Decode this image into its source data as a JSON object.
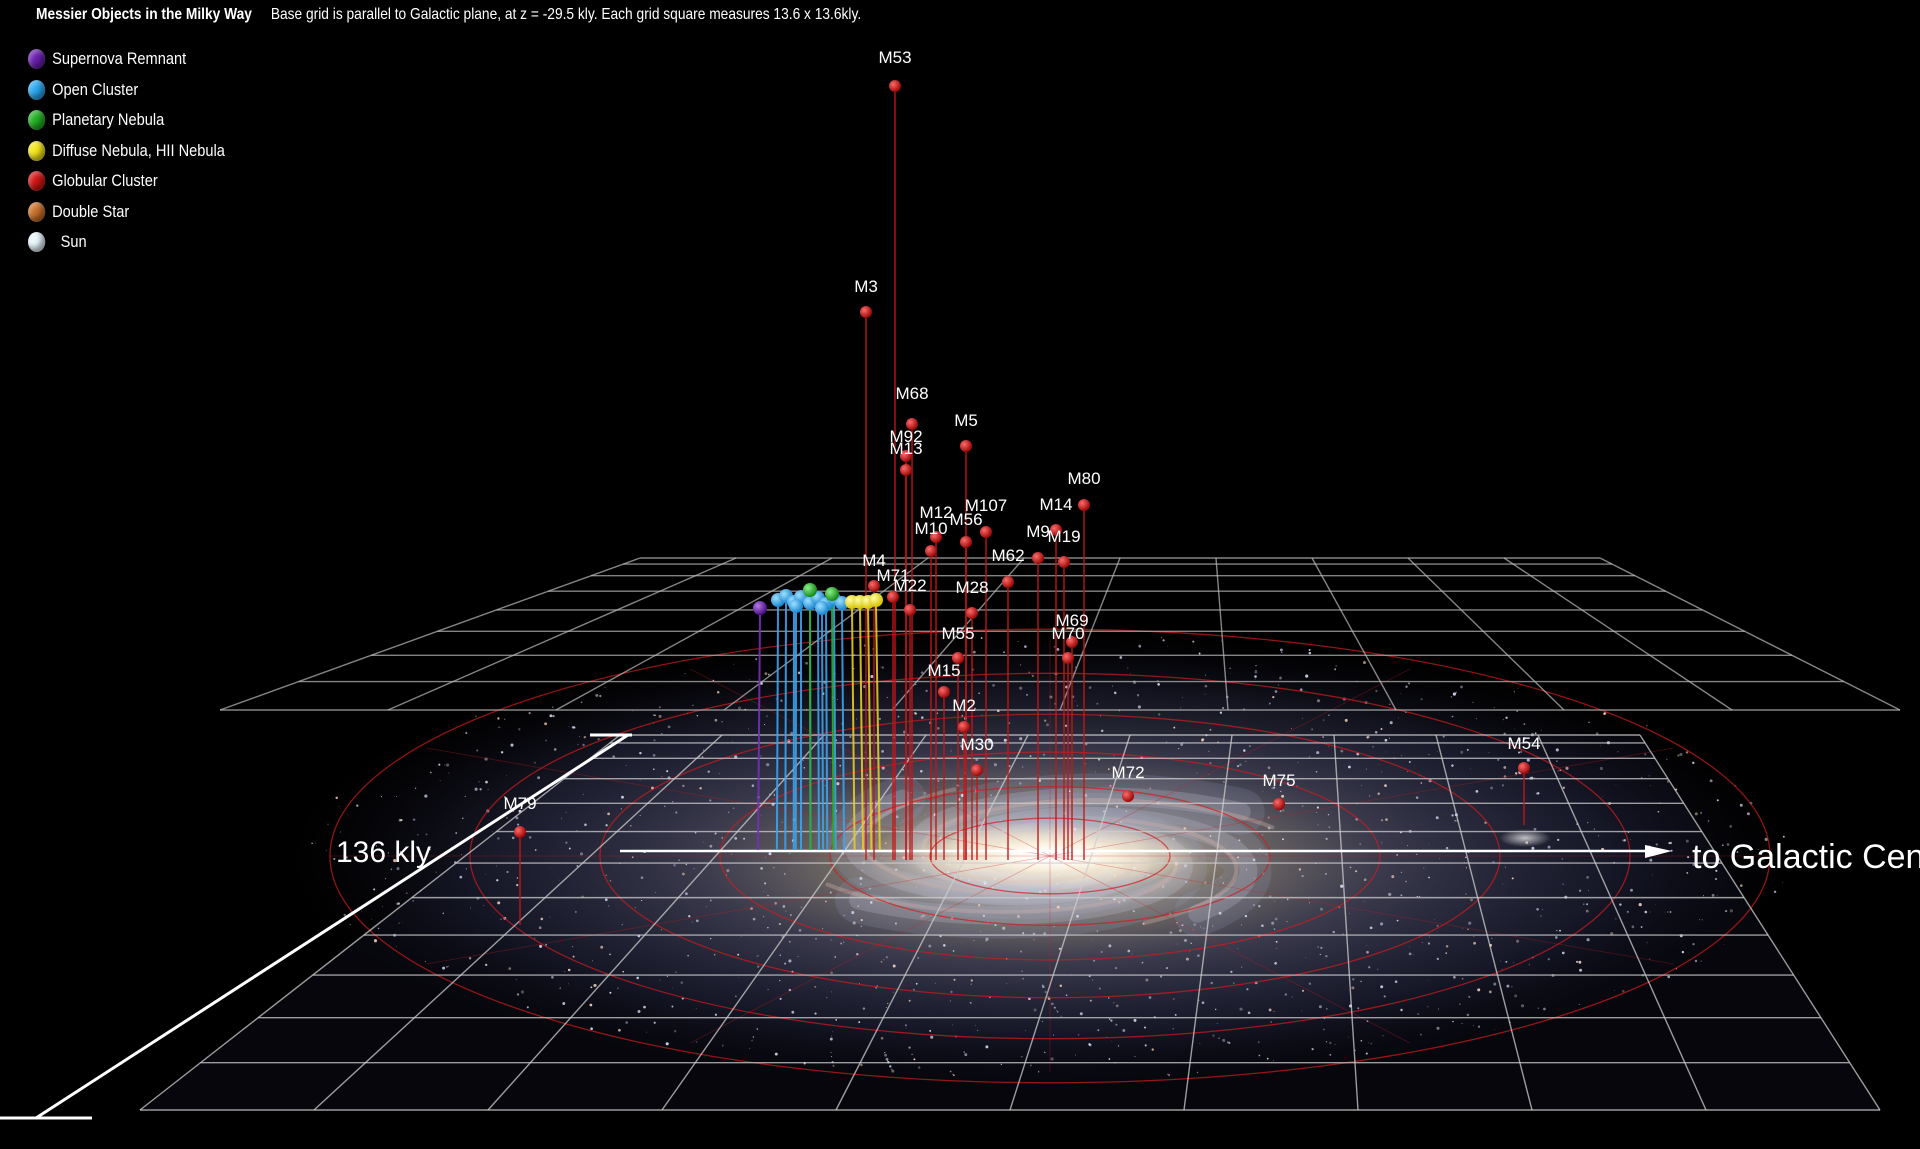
{
  "header": {
    "title": "Messier Objects in the Milky Way",
    "subtitle": "Base grid is parallel to Galactic plane, at z = -29.5 kly. Each grid square measures 13.6 x 13.6kly."
  },
  "legend": [
    {
      "label": "Supernova Remnant",
      "color": "#6a1fb0"
    },
    {
      "label": "Open Cluster",
      "color": "#29a8f0"
    },
    {
      "label": "Planetary Nebula",
      "color": "#22b022"
    },
    {
      "label": "Diffuse Nebula, HII Nebula",
      "color": "#f4e61a"
    },
    {
      "label": "Globular Cluster",
      "color": "#d21414"
    },
    {
      "label": "Double Star",
      "color": "#c8702a"
    },
    {
      "label": "Sun",
      "color": "#e8f6fb"
    }
  ],
  "scale_label": "136 kly",
  "direction_label": "to Galactic Center",
  "objects": [
    {
      "name": "M53",
      "type": "Globular Cluster"
    },
    {
      "name": "M3",
      "type": "Globular Cluster"
    },
    {
      "name": "M68",
      "type": "Globular Cluster"
    },
    {
      "name": "M5",
      "type": "Globular Cluster"
    },
    {
      "name": "M92",
      "type": "Globular Cluster"
    },
    {
      "name": "M13",
      "type": "Globular Cluster"
    },
    {
      "name": "M12",
      "type": "Globular Cluster"
    },
    {
      "name": "M107",
      "type": "Globular Cluster"
    },
    {
      "name": "M56",
      "type": "Globular Cluster"
    },
    {
      "name": "M10",
      "type": "Globular Cluster"
    },
    {
      "name": "M14",
      "type": "Globular Cluster"
    },
    {
      "name": "M80",
      "type": "Globular Cluster"
    },
    {
      "name": "M9",
      "type": "Globular Cluster"
    },
    {
      "name": "M19",
      "type": "Globular Cluster"
    },
    {
      "name": "M62",
      "type": "Globular Cluster"
    },
    {
      "name": "M4",
      "type": "Globular Cluster"
    },
    {
      "name": "M71",
      "type": "Globular Cluster"
    },
    {
      "name": "M22",
      "type": "Globular Cluster"
    },
    {
      "name": "M28",
      "type": "Globular Cluster"
    },
    {
      "name": "M69",
      "type": "Globular Cluster"
    },
    {
      "name": "M70",
      "type": "Globular Cluster"
    },
    {
      "name": "M55",
      "type": "Globular Cluster"
    },
    {
      "name": "M15",
      "type": "Globular Cluster"
    },
    {
      "name": "M2",
      "type": "Globular Cluster"
    },
    {
      "name": "M30",
      "type": "Globular Cluster"
    },
    {
      "name": "M72",
      "type": "Globular Cluster"
    },
    {
      "name": "M75",
      "type": "Globular Cluster"
    },
    {
      "name": "M54",
      "type": "Globular Cluster"
    },
    {
      "name": "M79",
      "type": "Globular Cluster"
    }
  ]
}
